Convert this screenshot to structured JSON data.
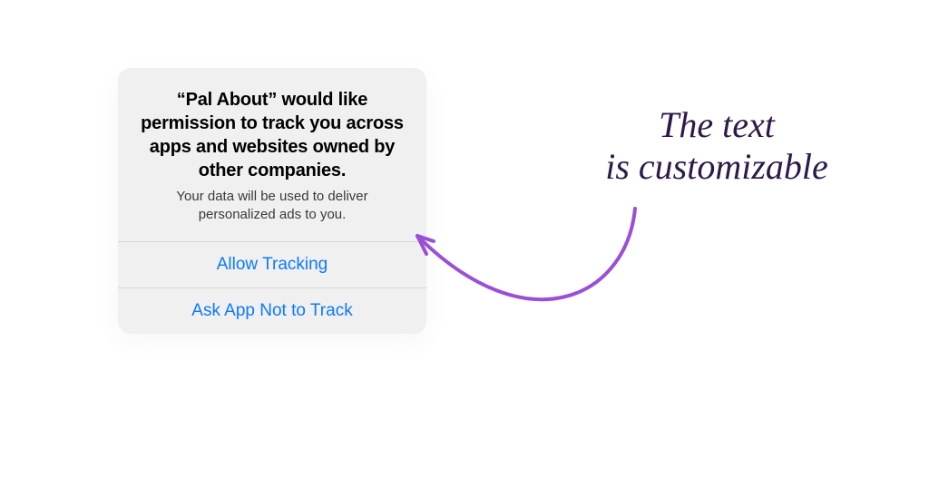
{
  "dialog": {
    "title": "“Pal About” would like permission to track you across apps and websites owned by other companies.",
    "subtitle": "Your data will be used to deliver personalized ads to you.",
    "allow_label": "Allow Tracking",
    "deny_label": "Ask App Not to Track"
  },
  "annotation": {
    "line1": "The text",
    "line2": "is customizable"
  },
  "colors": {
    "ios_blue": "#0a7aff",
    "annotation_ink": "#2e1a47",
    "arrow_stroke": "#9b4fd6"
  }
}
